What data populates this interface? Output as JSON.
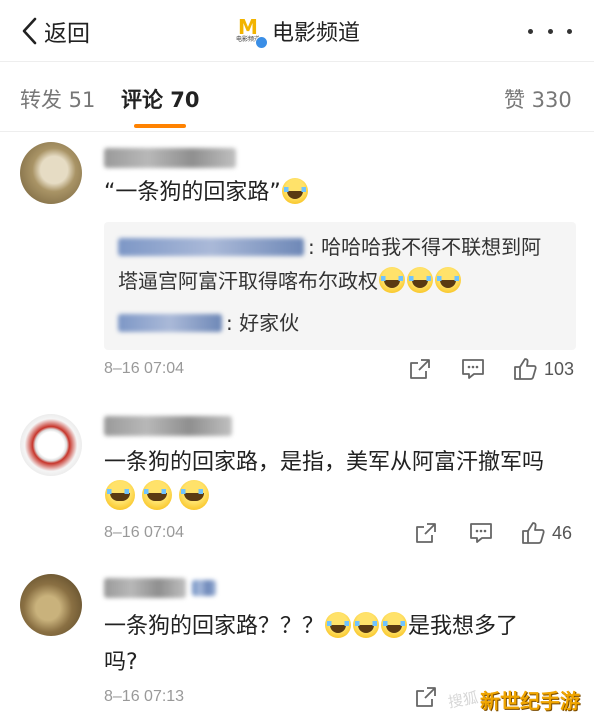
{
  "nav": {
    "back_label": "返回",
    "channel_name": "电影频道",
    "logo_mark": "M",
    "logo_sub": "电影频道"
  },
  "tabs": {
    "forward": "转发 51",
    "comment": "评论 70",
    "like": "赞 330"
  },
  "colors": {
    "accent": "#ff8200",
    "reply_bg": "#f5f5f5",
    "username_blue": "#6b86b8"
  },
  "comments": [
    {
      "text": "“一条狗的回家路”",
      "emoji": "laugh-cry",
      "replies": [
        {
          "line1": ": 哈哈哈我不得不联想到阿",
          "line2": "塔逼宫阿富汗取得喀布尔政权"
        },
        {
          "line1": ": 好家伙"
        }
      ],
      "time": "8–16 07:04",
      "likes": "103"
    },
    {
      "text": "一条狗的回家路，是指，美军从阿富汗撤军吗",
      "time": "8–16 07:04",
      "likes": "46"
    },
    {
      "text_a": "一条狗的回家路？？？",
      "text_b": "是我想多了",
      "text_c": "吗?",
      "time": "8–16 07:13"
    }
  ],
  "watermark": {
    "small": "搜狐",
    "big": "新世纪手游"
  }
}
